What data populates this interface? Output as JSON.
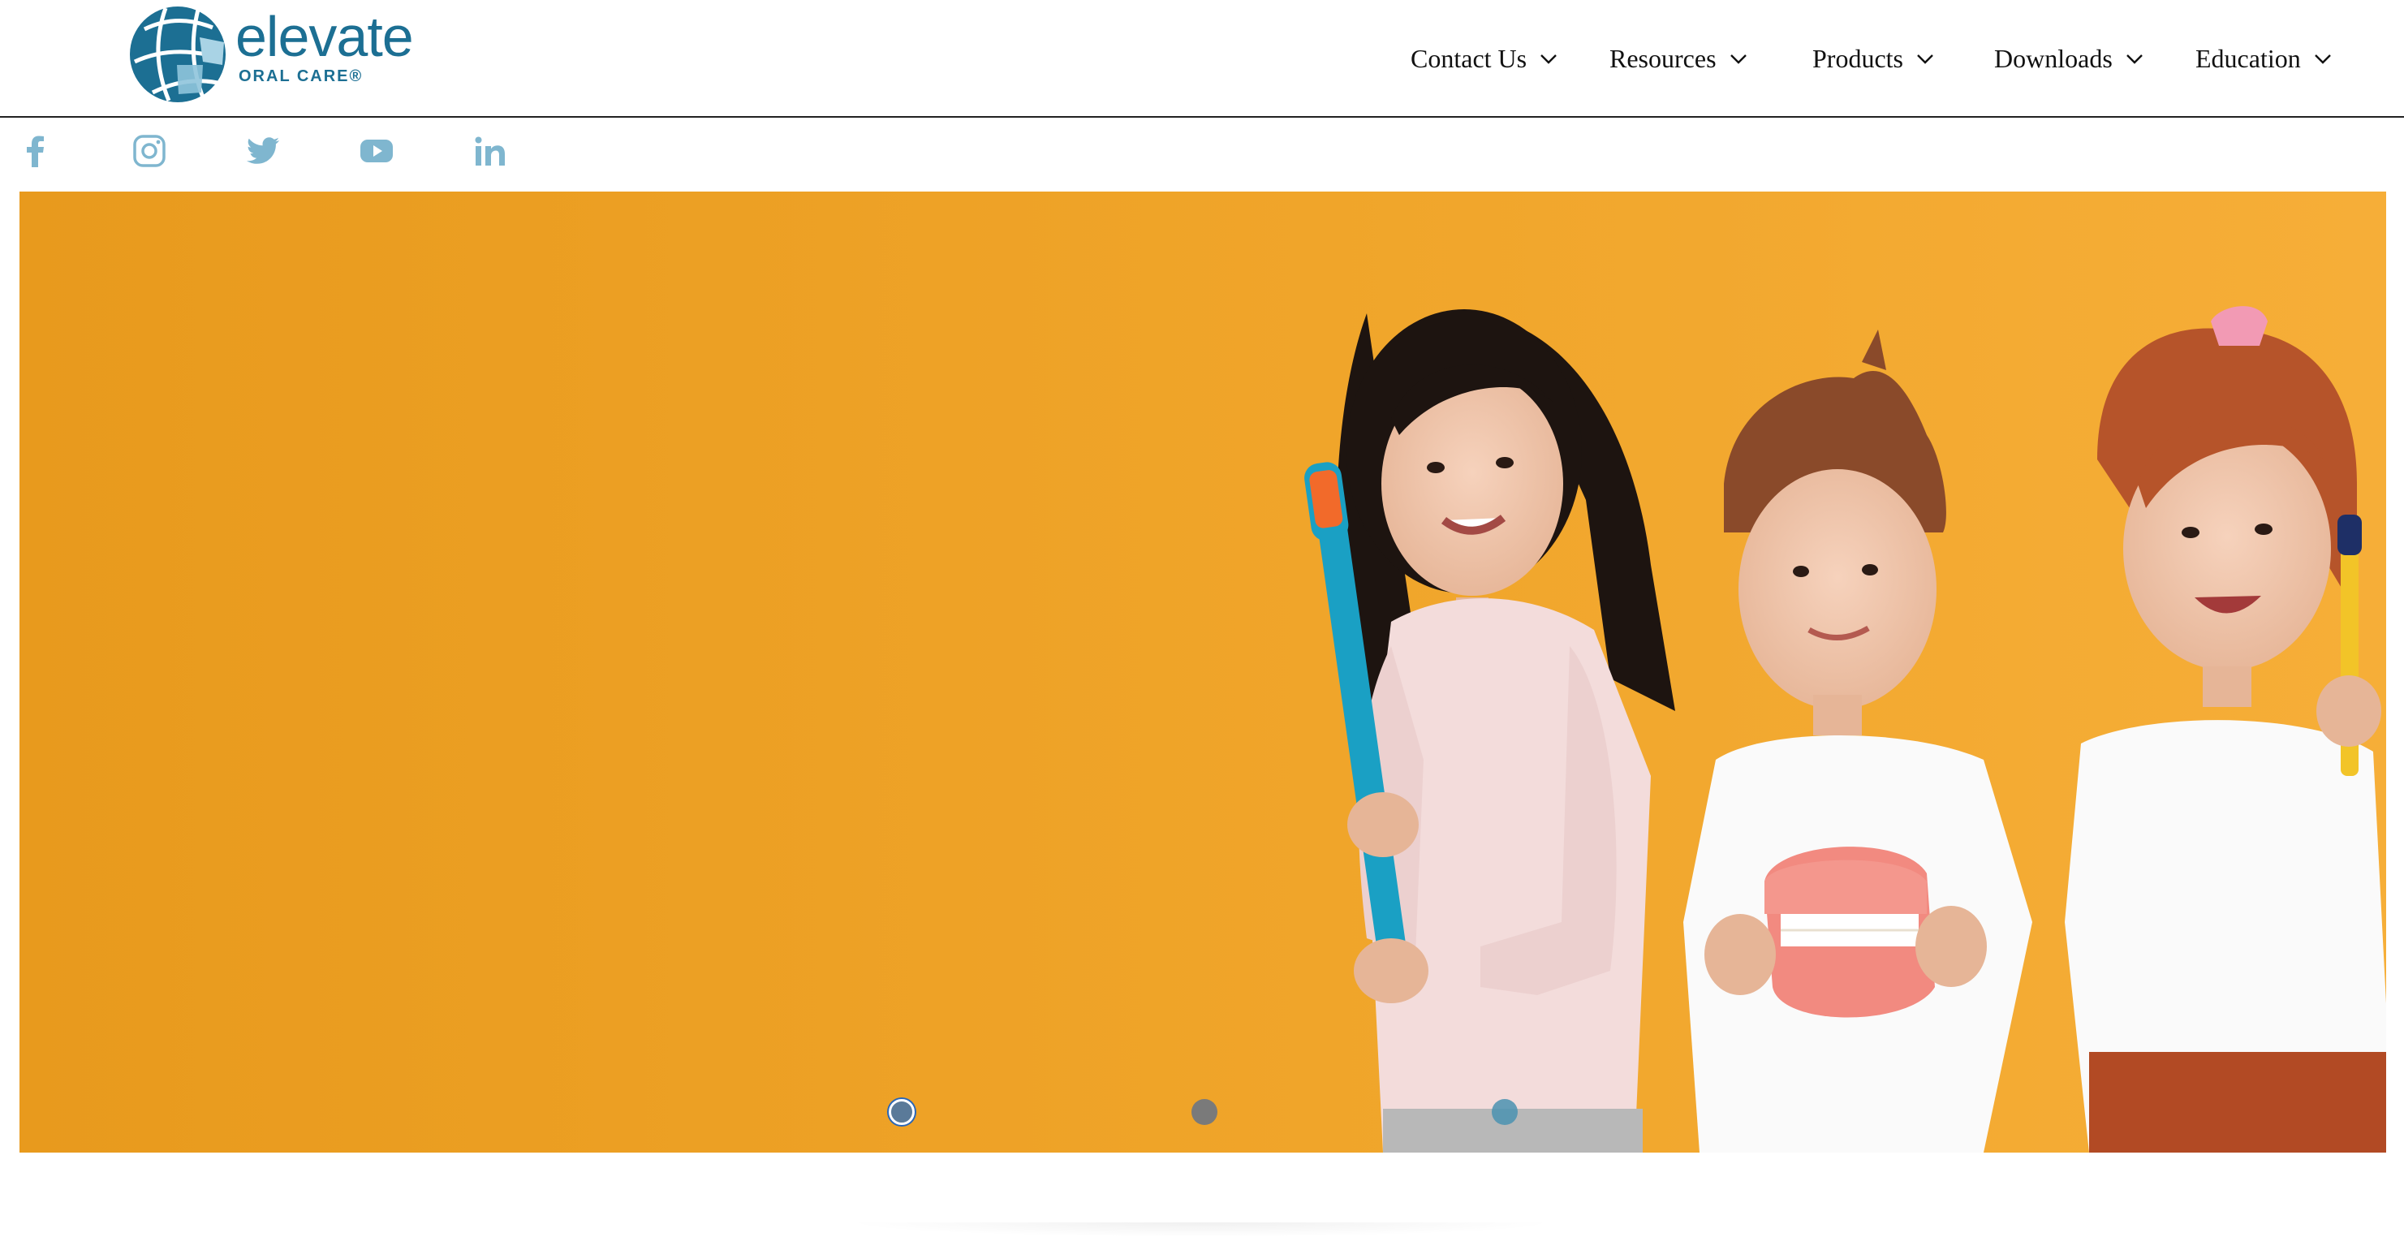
{
  "brand": {
    "name": "elevate",
    "subtitle": "ORAL CARE®",
    "color": "#1c6f93"
  },
  "nav": {
    "items": [
      {
        "label": "Contact Us",
        "icon": "chevron-down-icon"
      },
      {
        "label": "Resources",
        "icon": "chevron-down-icon"
      },
      {
        "label": "Products",
        "icon": "chevron-down-icon"
      },
      {
        "label": "Downloads",
        "icon": "chevron-down-icon"
      },
      {
        "label": "Education",
        "icon": "chevron-down-icon"
      }
    ]
  },
  "social": {
    "icon_color": "#7fb6cf",
    "items": [
      {
        "name": "facebook-icon"
      },
      {
        "name": "instagram-icon"
      },
      {
        "name": "twitter-icon"
      },
      {
        "name": "youtube-icon"
      },
      {
        "name": "linkedin-icon"
      }
    ]
  },
  "hero": {
    "background_color": "#f0a628",
    "image": "children-holding-toothbrushes-and-dental-model",
    "slides": {
      "count": 3,
      "active": 1
    }
  }
}
